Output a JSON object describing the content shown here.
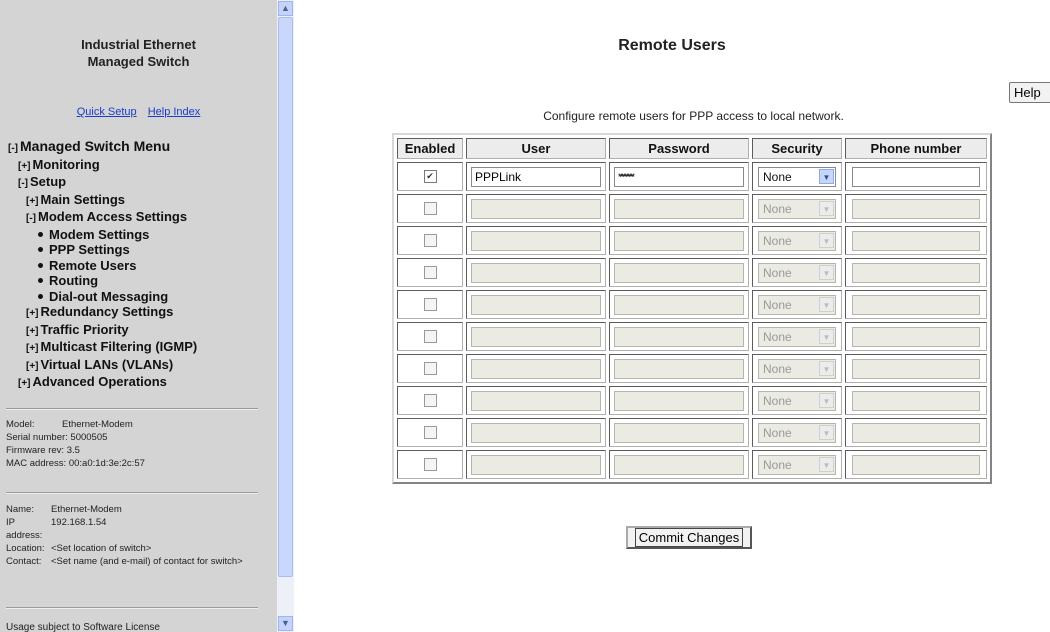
{
  "sidebar": {
    "brand_line1": "Industrial Ethernet",
    "brand_line2": "Managed Switch",
    "quick_setup": "Quick Setup",
    "help_index": "Help Index",
    "menu": {
      "expand": "[+]",
      "collapse": "[-]",
      "root": "Managed Switch Menu",
      "monitoring": "Monitoring",
      "setup": "Setup",
      "main_settings": "Main Settings",
      "modem_access": "Modem Access Settings",
      "modem_settings": "Modem Settings",
      "ppp_settings": "PPP Settings",
      "remote_users": "Remote Users",
      "routing": "Routing",
      "dialout": "Dial-out Messaging",
      "redundancy": "Redundancy Settings",
      "traffic": "Traffic Priority",
      "multicast": "Multicast Filtering (IGMP)",
      "vlans": "Virtual LANs (VLANs)",
      "advanced": "Advanced Operations"
    },
    "device": {
      "model_label": "Model:",
      "model": "Ethernet-Modem",
      "serial": "Serial number: 5000505",
      "firmware": "Firmware rev: 3.5",
      "mac": "MAC address: 00:a0:1d:3e:2c:57"
    },
    "switch": {
      "name_label": "Name:",
      "name": "Ethernet-Modem",
      "ip_label_1": "IP",
      "ip_label_2": "address:",
      "ip": "192.168.1.54",
      "location_label": "Location:",
      "location": "<Set location of switch>",
      "contact_label": "Contact:",
      "contact": "<Set name (and e-mail) of contact for switch>"
    },
    "license": "Usage subject to Software License"
  },
  "main": {
    "title": "Remote Users",
    "help_label": "Help",
    "description": "Configure remote users for PPP access to local network.",
    "columns": [
      "Enabled",
      "User",
      "Password",
      "Security",
      "Phone number"
    ],
    "rows": [
      {
        "enabled": true,
        "user": "PPPLink",
        "password": "**********",
        "security": "None",
        "phone": ""
      },
      {
        "enabled": false,
        "user": "",
        "password": "",
        "security": "None",
        "phone": ""
      },
      {
        "enabled": false,
        "user": "",
        "password": "",
        "security": "None",
        "phone": ""
      },
      {
        "enabled": false,
        "user": "",
        "password": "",
        "security": "None",
        "phone": ""
      },
      {
        "enabled": false,
        "user": "",
        "password": "",
        "security": "None",
        "phone": ""
      },
      {
        "enabled": false,
        "user": "",
        "password": "",
        "security": "None",
        "phone": ""
      },
      {
        "enabled": false,
        "user": "",
        "password": "",
        "security": "None",
        "phone": ""
      },
      {
        "enabled": false,
        "user": "",
        "password": "",
        "security": "None",
        "phone": ""
      },
      {
        "enabled": false,
        "user": "",
        "password": "",
        "security": "None",
        "phone": ""
      },
      {
        "enabled": false,
        "user": "",
        "password": "",
        "security": "None",
        "phone": ""
      }
    ],
    "commit_label": "Commit Changes"
  },
  "colors": {
    "sidebar_bg": "#d4d4d4",
    "link": "#1a3cc7",
    "scrollbar": "#c8d7fb"
  }
}
